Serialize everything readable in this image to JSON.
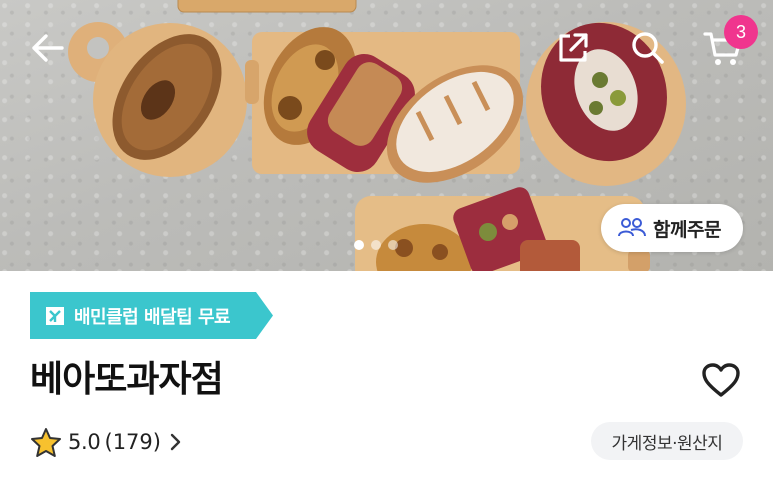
{
  "hero": {
    "cart_count": "3",
    "together_order_label": "함께주문",
    "carousel_pages": 3,
    "carousel_active": 1
  },
  "store": {
    "badge_text": "배민클럽 배달팁 무료",
    "name": "베아또과자점",
    "rating": "5.0",
    "review_count": "(179)",
    "info_button_label": "가게정보·원산지"
  },
  "icons": {
    "back": "arrow-left-icon",
    "share": "share-icon",
    "search": "search-icon",
    "cart": "cart-icon",
    "people": "people-icon",
    "club": "club-logo-icon",
    "favorite": "heart-icon",
    "star": "star-icon",
    "chevron": "chevron-right-icon"
  },
  "colors": {
    "badge_bg": "#3bc6cd",
    "cart_badge": "#f0358e",
    "star_fill": "#f7c12e",
    "people_icon": "#3b5bd6"
  }
}
